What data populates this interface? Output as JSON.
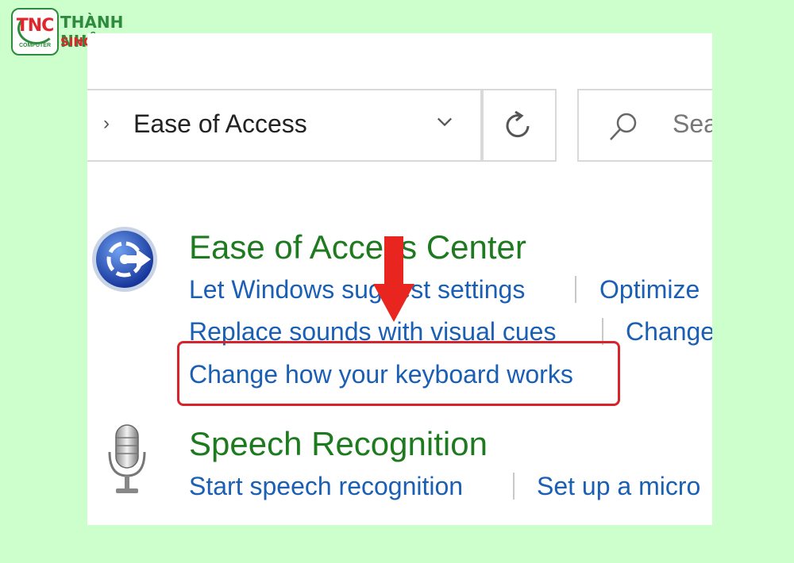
{
  "watermark": {
    "badge_text": "TNC",
    "badge_sub": "COMPUTER",
    "name": "THÀNH NHÂN",
    "since": "SINCE 1994",
    "colors": {
      "green": "#2e8b3d",
      "red": "#e0262b"
    }
  },
  "address_bar": {
    "breadcrumb": "Ease of Access",
    "dropdown_icon": "chevron-down-icon",
    "refresh_icon": "refresh-icon"
  },
  "search": {
    "placeholder": "Sea",
    "icon": "search-icon"
  },
  "categories": [
    {
      "title": "Ease of Access Center",
      "icon": "ease-of-access-icon",
      "links": [
        "Let Windows suggest settings",
        "Optimize",
        "Replace sounds with visual cues",
        "Change",
        "Change how your keyboard works"
      ]
    },
    {
      "title": "Speech Recognition",
      "icon": "microphone-icon",
      "links": [
        "Start speech recognition",
        "Set up a micro"
      ]
    }
  ],
  "annotation": {
    "highlighted_link": "Change how your keyboard works",
    "highlight_color": "#d9232a",
    "arrow_icon": "down-arrow-icon"
  },
  "colors": {
    "page_background": "#ccffcc",
    "category_title": "#1e7a1e",
    "link": "#1a5fb4"
  }
}
